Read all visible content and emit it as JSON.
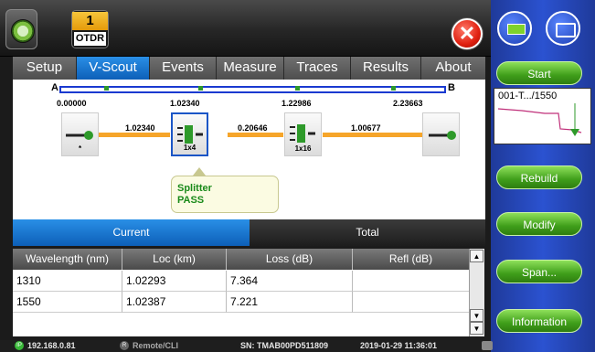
{
  "header": {
    "otdr_number": "1",
    "otdr_label": "OTDR",
    "close_symbol": "✕"
  },
  "tabs": [
    "Setup",
    "V-Scout",
    "Events",
    "Measure",
    "Traces",
    "Results",
    "About"
  ],
  "active_tab": "V-Scout",
  "scout": {
    "end_a": "A",
    "end_b": "B",
    "positions": [
      "0.00000",
      "1.02340",
      "1.22986",
      "2.23663"
    ],
    "segments": [
      "1.02340",
      "0.20646",
      "1.00677"
    ],
    "event_labels": [
      "*",
      "1x4",
      "1x16",
      ""
    ],
    "callout_title": "Splitter",
    "callout_status": "PASS"
  },
  "results_toggle": {
    "current": "Current",
    "total": "Total"
  },
  "table": {
    "headers": [
      "Wavelength (nm)",
      "Loc (km)",
      "Loss (dB)",
      "Refl (dB)"
    ],
    "rows": [
      [
        "1310",
        "1.02293",
        "7.364",
        ""
      ],
      [
        "1550",
        "1.02387",
        "7.221",
        ""
      ]
    ]
  },
  "right_panel": {
    "start": "Start",
    "trace_name": "001-T.../1550",
    "rebuild": "Rebuild",
    "modify": "Modify",
    "span": "Span...",
    "information": "Information"
  },
  "status": {
    "ip_badge": "IP",
    "ip": "192.168.0.81",
    "remote_badge": "R",
    "remote": "Remote/CLI",
    "serial": "SN: TMAB00PD511809",
    "datetime": "2019-01-29  11:36:01"
  },
  "colors": {
    "accent": "#1a74d2",
    "green_button": "#4caf22",
    "segment": "#f6a52a",
    "pass": "#1a8a1a"
  }
}
